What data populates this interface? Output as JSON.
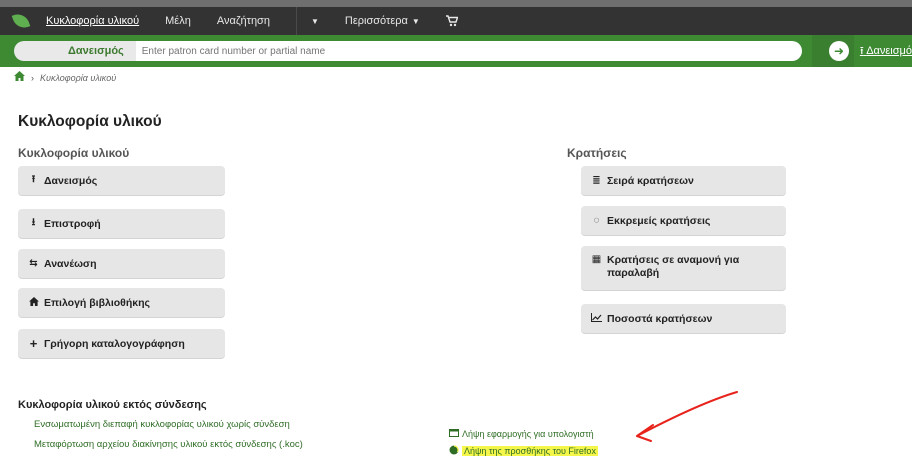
{
  "navbar": {
    "items": [
      {
        "label": "Κυκλοφορία υλικού",
        "active": true
      },
      {
        "label": "Μέλη"
      },
      {
        "label": "Αναζήτηση"
      },
      {
        "label": "Περισσότερα",
        "has_caret": true
      }
    ],
    "cart_icon": "cart-icon"
  },
  "search": {
    "label": "Δανεισμός",
    "placeholder": "Enter patron card number or partial name",
    "go_icon": "arrow-right-icon",
    "checkout_link": "Δανεισμό"
  },
  "breadcrumb": {
    "home_icon": "home-icon",
    "current": "Κυκλοφορία υλικού"
  },
  "page_title": "Κυκλοφορία υλικού",
  "left_column": {
    "heading": "Κυκλοφορία υλικού",
    "buttons": [
      {
        "label": "Δανεισμός",
        "icon": "upload-icon"
      },
      {
        "label": "Επιστροφή",
        "icon": "download-icon"
      },
      {
        "label": "Ανανέωση",
        "icon": "retweet-icon"
      },
      {
        "label": "Επιλογή βιβλιοθήκης",
        "icon": "home-icon"
      },
      {
        "label": "Γρήγορη καταλογογράφηση",
        "icon": "plus-icon"
      }
    ]
  },
  "right_column": {
    "heading": "Κρατήσεις",
    "buttons": [
      {
        "label": "Σειρά κρατήσεων",
        "icon": "list-icon"
      },
      {
        "label": "Εκκρεμείς κρατήσεις",
        "icon": "hand-icon"
      },
      {
        "label": "Κρατήσεις σε αναμονή για παραλαβή",
        "icon": "calendar-icon"
      },
      {
        "label": "Ποσοστά κρατήσεων",
        "icon": "line-chart-icon"
      }
    ]
  },
  "offline": {
    "heading": "Κυκλοφορία υλικού εκτός σύνδεσης",
    "links": [
      "Ενσωματωμένη διεπαφή κυκλοφορίας υλικού χωρίς σύνδεση",
      "Μεταφόρτωση αρχείου διακίνησης υλικού εκτός σύνδεσης (.koc)"
    ]
  },
  "downloads": {
    "desktop_app": "Λήψη εφαρμογής για υπολογιστή",
    "firefox_addon": "Λήψη της προσθήκης του Firefox"
  },
  "colors": {
    "navbar": "#333333",
    "searchbar": "#3d8a33",
    "link": "#2f6d26",
    "button_bg": "#e6e6e6",
    "highlight": "#f4f64a",
    "annotation": "#e8231c"
  }
}
